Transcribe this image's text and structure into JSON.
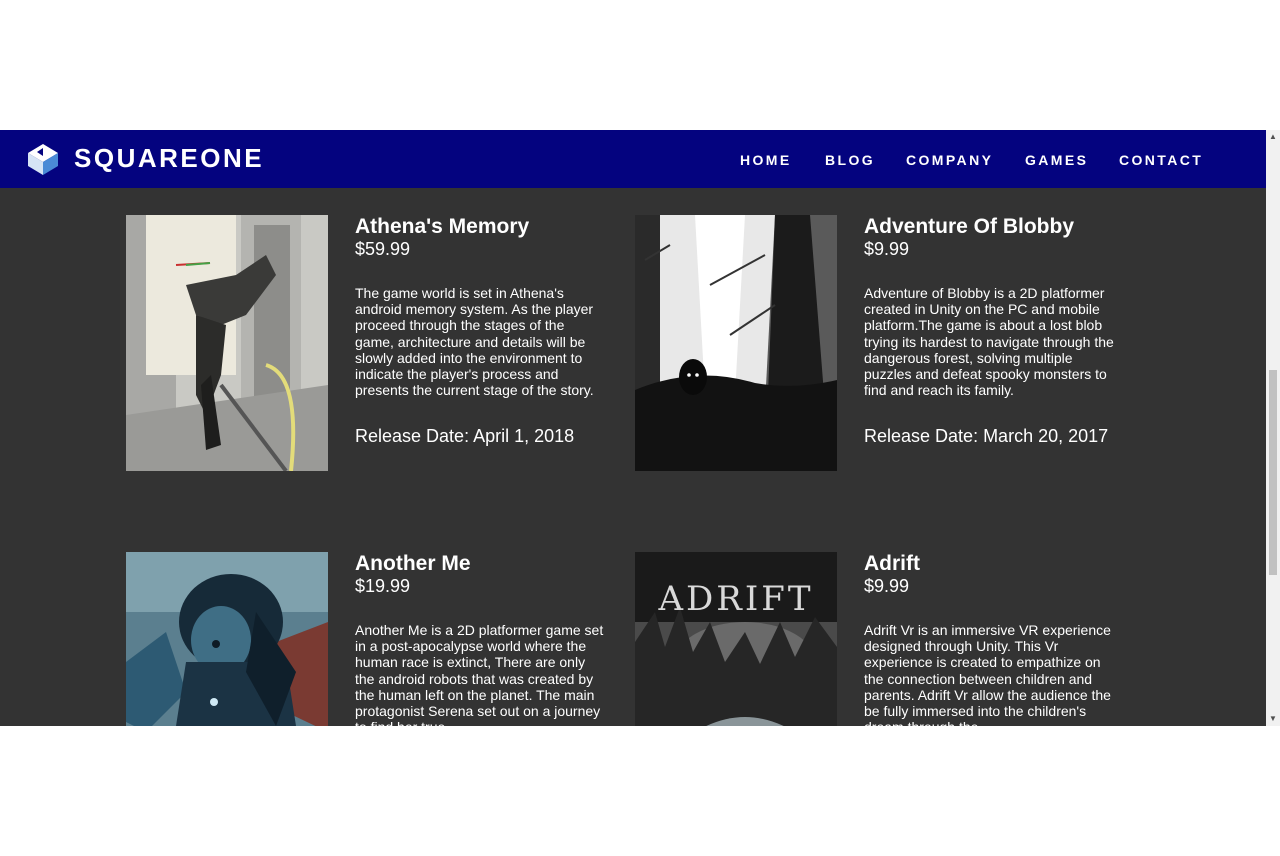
{
  "header": {
    "brand": "SQUAREONE",
    "nav": [
      "HOME",
      "BLOG",
      "COMPANY",
      "GAMES",
      "CONTACT"
    ],
    "colors": {
      "navbar": "#04037f",
      "content_bg": "#333333"
    }
  },
  "games": [
    {
      "title": "Athena's Memory",
      "price": "$59.99",
      "description": "The game world is set in Athena's android memory system. As the player proceed through the stages of the game, architecture and details will be slowly added into the environment to indicate the player's process and presents the current stage of the story.",
      "release": "Release Date: April 1, 2018"
    },
    {
      "title": "Adventure Of Blobby",
      "price": "$9.99",
      "description": "Adventure of Blobby is a 2D platformer created in Unity on the PC and mobile platform.The game is about a lost blob trying its hardest to navigate through the dangerous forest, solving multiple puzzles and defeat spooky monsters to find and reach its family.",
      "release": "Release Date: March 20, 2017"
    },
    {
      "title": "Another Me",
      "price": "$19.99",
      "description": "Another Me is a 2D platformer game set in a post-apocalypse world where the human race is extinct, There are only the android robots that was created by the human left on the planet. The main protagonist Serena set out on a journey to find her true",
      "release": ""
    },
    {
      "title": "Adrift",
      "price": "$9.99",
      "cover_text": "ADRIFT",
      "description": "Adrift Vr is an immersive VR experience designed through Unity. This Vr experience is created to empathize on the connection between children and parents. Adrift Vr allow the audience the be fully immersed into the children's dream through the",
      "release": ""
    }
  ]
}
